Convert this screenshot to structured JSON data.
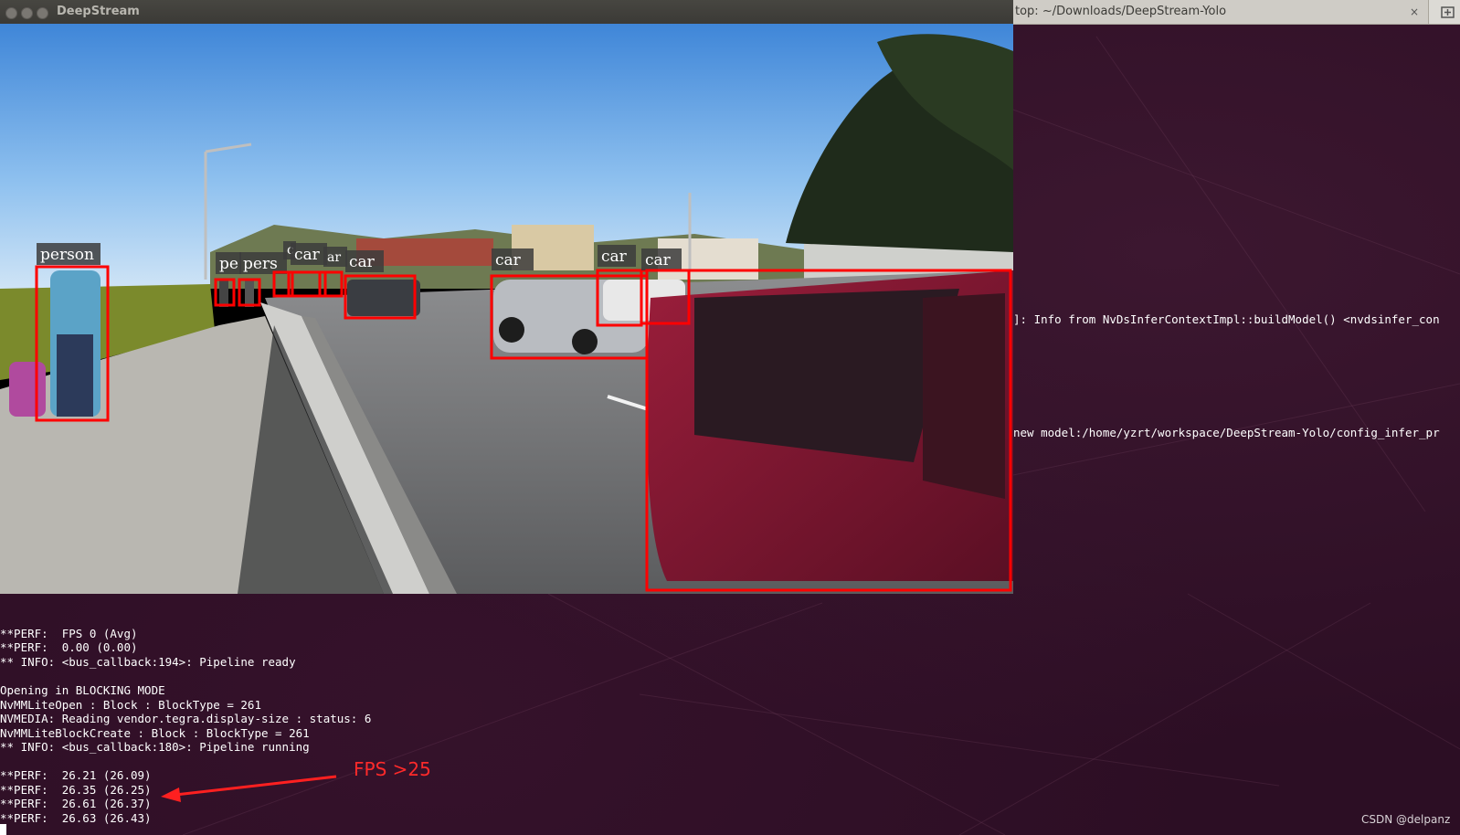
{
  "deepstream_window": {
    "title": "DeepStream",
    "window_buttons": [
      "close-icon",
      "minimize-icon",
      "maximize-icon"
    ],
    "detections": [
      {
        "label": "person"
      },
      {
        "label": "pe"
      },
      {
        "label": "pers"
      },
      {
        "label": "c"
      },
      {
        "label": "car"
      },
      {
        "label": "ar"
      },
      {
        "label": "car"
      },
      {
        "label": "car"
      },
      {
        "label": "car"
      },
      {
        "label": "car"
      }
    ],
    "box_color": "#ff0000"
  },
  "terminal": {
    "tab_title": "top: ~/Downloads/DeepStream-Yolo",
    "tab_close": "×",
    "new_tab_icon": "new-tab-icon",
    "right_lines": [
      "]: Info from NvDsInferContextImpl::buildModel() <nvdsinfer_con",
      "new model:/home/yzrt/workspace/DeepStream-Yolo/config_infer_pr"
    ],
    "lines": [
      "**PERF:  FPS 0 (Avg)",
      "**PERF:  0.00 (0.00)",
      "** INFO: <bus_callback:194>: Pipeline ready",
      "",
      "Opening in BLOCKING MODE",
      "NvMMLiteOpen : Block : BlockType = 261",
      "NVMEDIA: Reading vendor.tegra.display-size : status: 6",
      "NvMMLiteBlockCreate : Block : BlockType = 261",
      "** INFO: <bus_callback:180>: Pipeline running",
      "",
      "**PERF:  26.21 (26.09)",
      "**PERF:  26.35 (26.25)",
      "**PERF:  26.61 (26.37)",
      "**PERF:  26.63 (26.43)"
    ],
    "background_color": "#2c0e24"
  },
  "annotation": {
    "text": "FPS >25",
    "color": "#ff2a2a"
  },
  "watermark": "CSDN @delpanz"
}
